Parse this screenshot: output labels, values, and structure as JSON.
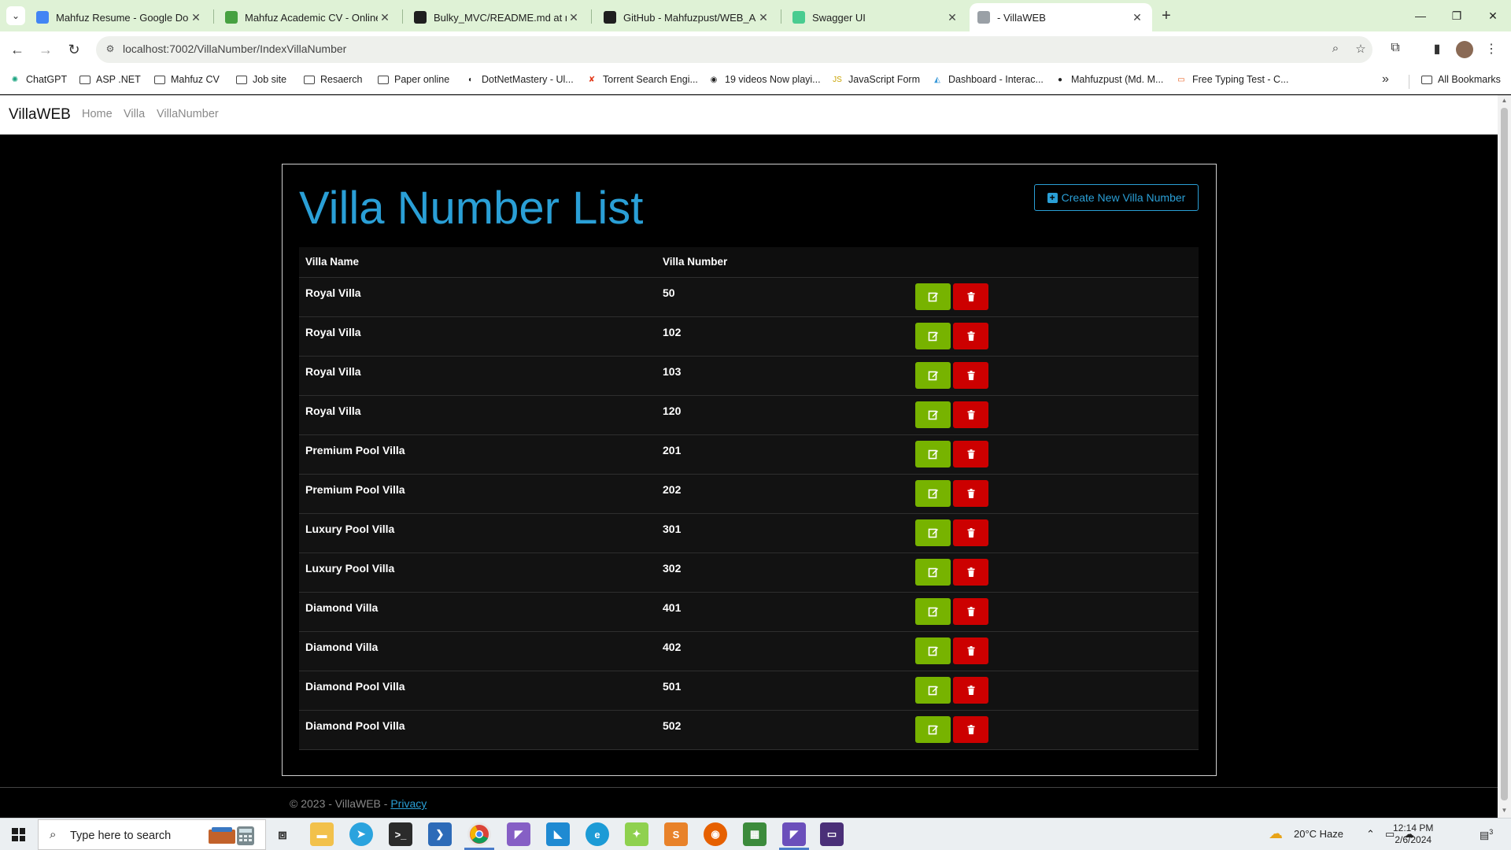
{
  "browser": {
    "tabs": [
      {
        "title": "Mahfuz Resume - Google Docs",
        "icon": "google-docs-icon",
        "color": "#4285f4"
      },
      {
        "title": "Mahfuz Academic CV - Online LaTeX",
        "icon": "overleaf-icon",
        "color": "#47a141"
      },
      {
        "title": "Bulky_MVC/README.md at new",
        "icon": "github-icon",
        "color": "#1f1f1f"
      },
      {
        "title": "GitHub - Mahfuzpust/WEB_API",
        "icon": "github-icon",
        "color": "#1f1f1f"
      },
      {
        "title": "Swagger UI",
        "icon": "swagger-icon",
        "color": "#49cc90"
      },
      {
        "title": "- VillaWEB",
        "icon": "page-icon",
        "color": "#9aa0a6"
      }
    ],
    "url": "localhost:7002/VillaNumber/IndexVillaNumber",
    "bookmarks": [
      {
        "label": "ChatGPT",
        "icon": "chatgpt-icon"
      },
      {
        "label": "ASP .NET",
        "icon": "folder-icon"
      },
      {
        "label": "Mahfuz CV",
        "icon": "folder-icon"
      },
      {
        "label": "Job site",
        "icon": "folder-icon"
      },
      {
        "label": "Resaerch",
        "icon": "folder-icon"
      },
      {
        "label": "Paper online",
        "icon": "folder-icon"
      },
      {
        "label": "DotNetMastery - Ul...",
        "icon": "dotnetmastery-icon"
      },
      {
        "label": "Torrent Search Engi...",
        "icon": "torrent-icon"
      },
      {
        "label": "19 videos Now playi...",
        "icon": "video-icon"
      },
      {
        "label": "JavaScript Form",
        "icon": "javascript-icon"
      },
      {
        "label": "Dashboard - Interac...",
        "icon": "dashboard-icon"
      },
      {
        "label": "Mahfuzpust (Md. M...",
        "icon": "github-icon"
      },
      {
        "label": "Free Typing Test - C...",
        "icon": "typing-icon"
      }
    ],
    "all_bookmarks": "All Bookmarks"
  },
  "site": {
    "brand": "VillaWEB",
    "nav": [
      "Home",
      "Villa",
      "VillaNumber"
    ],
    "page_title": "Villa Number List",
    "create_button": "Create New Villa Number",
    "table": {
      "headers": [
        "Villa Name",
        "Villa Number"
      ],
      "rows": [
        {
          "name": "Royal Villa",
          "number": "50"
        },
        {
          "name": "Royal Villa",
          "number": "102"
        },
        {
          "name": "Royal Villa",
          "number": "103"
        },
        {
          "name": "Royal Villa",
          "number": "120"
        },
        {
          "name": "Premium Pool Villa",
          "number": "201"
        },
        {
          "name": "Premium Pool Villa",
          "number": "202"
        },
        {
          "name": "Luxury Pool Villa",
          "number": "301"
        },
        {
          "name": "Luxury Pool Villa",
          "number": "302"
        },
        {
          "name": "Diamond Villa",
          "number": "401"
        },
        {
          "name": "Diamond Villa",
          "number": "402"
        },
        {
          "name": "Diamond Pool Villa",
          "number": "501"
        },
        {
          "name": "Diamond Pool Villa",
          "number": "502"
        }
      ]
    },
    "footer": {
      "text": "© 2023 - VillaWEB - ",
      "privacy": "Privacy"
    },
    "colors": {
      "accent": "#2a9fd6",
      "edit": "#77b300",
      "delete": "#cc0000"
    }
  },
  "taskbar": {
    "search_placeholder": "Type here to search",
    "weather": "20°C  Haze",
    "time": "12:14 PM",
    "date": "2/6/2024",
    "notifications": "3"
  }
}
